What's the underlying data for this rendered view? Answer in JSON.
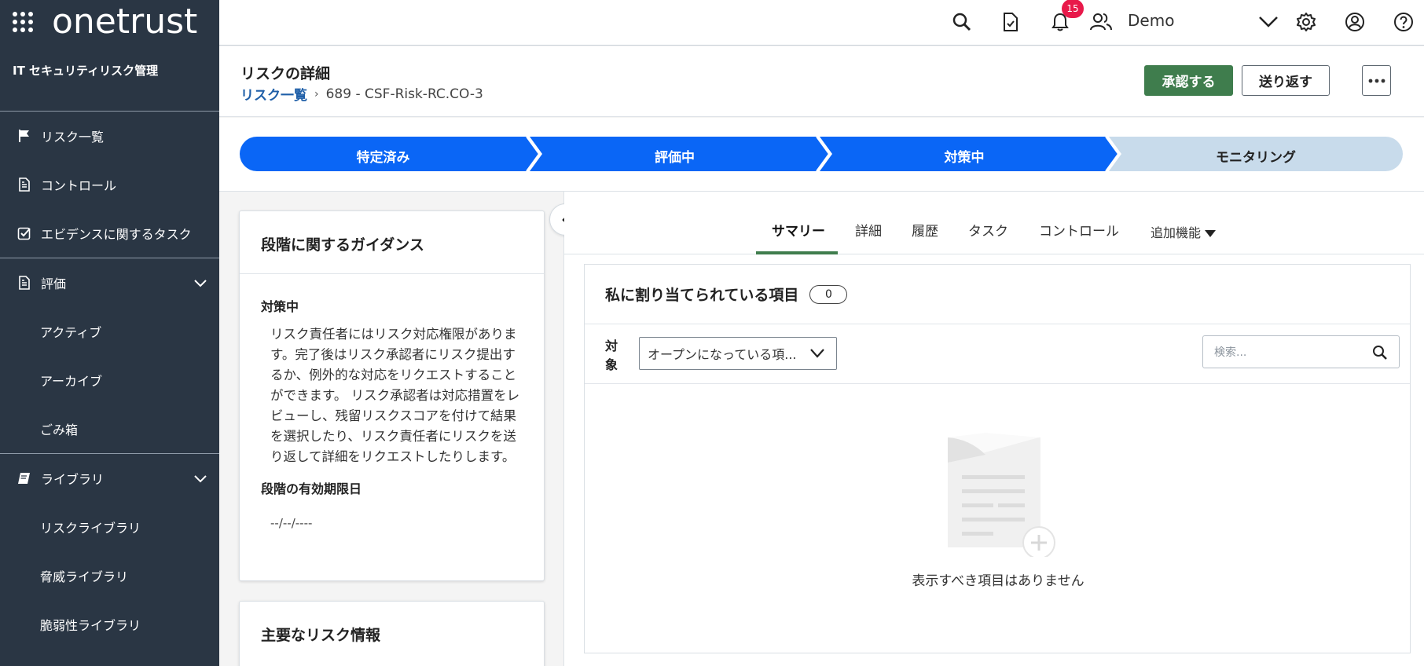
{
  "brand": {
    "logo_text": "onetrust"
  },
  "sidebar": {
    "module_title": "IT セキュリティリスク管理",
    "items": [
      {
        "label": "リスク一覧",
        "icon": "flag-icon"
      },
      {
        "label": "コントロール",
        "icon": "document-icon"
      },
      {
        "label": "エビデンスに関するタスク",
        "icon": "checkbox-icon"
      }
    ],
    "assessment": {
      "label": "評価",
      "icon": "document-icon",
      "subitems": [
        "アクティブ",
        "アーカイブ",
        "ごみ箱"
      ]
    },
    "library": {
      "label": "ライブラリ",
      "icon": "book-icon",
      "subitems": [
        "リスクライブラリ",
        "脅威ライブラリ",
        "脆弱性ライブラリ"
      ]
    }
  },
  "topbar": {
    "notification_count": "15",
    "user_name": "Demo"
  },
  "page": {
    "title": "リスクの詳細",
    "breadcrumb_link": "リスク一覧",
    "breadcrumb_current": "689 - CSF-Risk-RC.CO-3",
    "approve_label": "承認する",
    "send_back_label": "送り返す"
  },
  "stages": [
    {
      "label": "特定済み",
      "state": "done"
    },
    {
      "label": "評価中",
      "state": "done"
    },
    {
      "label": "対策中",
      "state": "current"
    },
    {
      "label": "モニタリング",
      "state": "pending"
    }
  ],
  "guidance": {
    "title": "段階に関するガイダンス",
    "stage_name": "対策中",
    "text": "リスク責任者にはリスク対応権限があります。完了後はリスク承認者にリスク提出するか、例外的な対応をリクエストすることができます。 リスク承認者は対応措置をレビューし、残留リスクスコアを付けて結果を選択したり、リスク責任者にリスクを送り返して詳細をリクエストしたりします。",
    "expiry_label": "段階の有効期限日",
    "expiry_value": "--/--/----"
  },
  "key_info": {
    "title": "主要なリスク情報"
  },
  "tabs": [
    {
      "label": "サマリー",
      "active": true
    },
    {
      "label": "詳細"
    },
    {
      "label": "履歴"
    },
    {
      "label": "タスク"
    },
    {
      "label": "コントロール"
    },
    {
      "label": "追加機能"
    }
  ],
  "assigned": {
    "title": "私に割り当てられている項目",
    "count": "0",
    "filter_label": "対象",
    "filter_value": "オープンになっている項...",
    "search_placeholder": "検索...",
    "empty_text": "表示すべき項目はありません"
  },
  "colors": {
    "sidebar_bg": "#2a3644",
    "stage_active": "#0a66f6",
    "stage_pending": "#c8dbeb",
    "primary_button": "#3f7d4d",
    "badge": "#e8194a"
  }
}
